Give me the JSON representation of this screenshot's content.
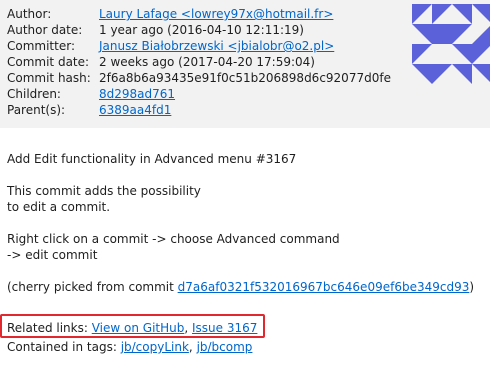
{
  "commit_info": {
    "author_label": "Author:",
    "author_value": "Laury Lafage <lowrey97x@hotmail.fr>",
    "author_date_label": "Author date:",
    "author_date_value": "1 year ago (2016-04-10 12:11:19)",
    "committer_label": "Committer:",
    "committer_value": "Janusz Białobrzewski <jbialobr@o2.pl>",
    "commit_date_label": "Commit date:",
    "commit_date_value": "2 weeks ago (2017-04-20 17:59:04)",
    "commit_hash_label": "Commit hash:",
    "commit_hash_value": "2f6a8b6a93435e91f0c51b206898d6c92077d0fe",
    "children_label": "Children:",
    "children_value": "8d298ad761",
    "parents_label": "Parent(s):",
    "parents_value": "6389aa4fd1"
  },
  "message": {
    "title": "Add Edit functionality in Advanced menu #3167",
    "body_line_1": "This commit adds the possibility",
    "body_line_2": "to edit a commit.",
    "body_line_3": "Right click on a commit -> choose Advanced command",
    "body_line_4": "-> edit commit",
    "cherry_prefix": "(cherry picked from commit ",
    "cherry_hash": "d7a6af0321f532016967bc646e09ef6be349cd93",
    "cherry_suffix": ")"
  },
  "related": {
    "label": "Related links: ",
    "github_link": "View on GitHub",
    "separator": ", ",
    "issue_link": "Issue 3167"
  },
  "tags": {
    "label": "Contained in tags: ",
    "tag_1": "jb/copyLink",
    "separator": ", ",
    "tag_2": "jb/bcomp"
  },
  "colors": {
    "link": "#0066cc",
    "highlight": "#e0282e",
    "avatar": "#5b61d8",
    "panel": "#f2f2f2"
  },
  "icons": {
    "avatar": "identicon-avatar"
  }
}
